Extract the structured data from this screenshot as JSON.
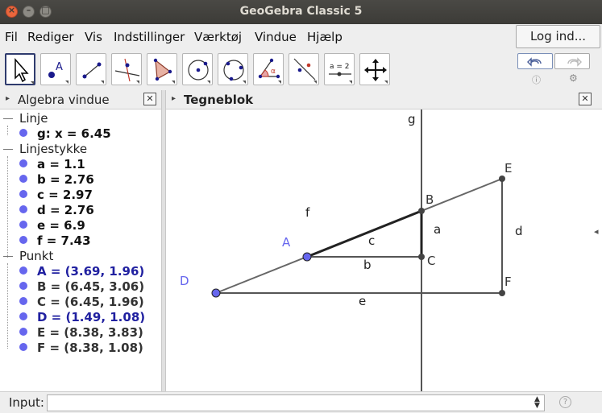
{
  "window": {
    "title": "GeoGebra Classic 5"
  },
  "menu": {
    "items": [
      "Fil",
      "Rediger",
      "Vis",
      "Indstillinger",
      "Værktøj",
      "Vindue",
      "Hjælp"
    ],
    "login_label": "Log ind..."
  },
  "toolbar": {
    "tools": [
      "move-tool",
      "point-tool",
      "segment-tool",
      "perpendicular-line-tool",
      "polygon-tool",
      "circle-center-point-tool",
      "circle-three-points-tool",
      "angle-tool",
      "reflect-tool",
      "slider-tool",
      "move-graphics-view-tool"
    ],
    "slider_label": "a = 2",
    "point_label": "A",
    "angle_label": "α"
  },
  "algebra": {
    "title": "Algebra vindue",
    "categories": [
      {
        "name": "Linje",
        "items": [
          "g: x = 6.45"
        ]
      },
      {
        "name": "Linjestykke",
        "items": [
          "a = 1.1",
          "b = 2.76",
          "c = 2.97",
          "d = 2.76",
          "e = 6.9",
          "f = 7.43"
        ]
      },
      {
        "name": "Punkt",
        "items": [
          "A = (3.69, 1.96)",
          "B = (6.45, 3.06)",
          "C = (6.45, 1.96)",
          "D = (1.49, 1.08)",
          "E = (8.38, 3.83)",
          "F = (8.38, 1.08)"
        ]
      }
    ]
  },
  "graphics": {
    "title": "Tegneblok",
    "labels": {
      "line_g": "g",
      "segment_f": "f",
      "segment_c": "c",
      "segment_a": "a",
      "segment_b": "b",
      "segment_d": "d",
      "segment_e": "e",
      "point_A": "A",
      "point_B": "B",
      "point_C": "C",
      "point_D": "D",
      "point_E": "E",
      "point_F": "F"
    },
    "points": {
      "A": [
        3.69,
        1.96
      ],
      "B": [
        6.45,
        3.06
      ],
      "C": [
        6.45,
        1.96
      ],
      "D": [
        1.49,
        1.08
      ],
      "E": [
        8.38,
        3.83
      ],
      "F": [
        8.38,
        1.08
      ]
    },
    "line_g_x": 6.45
  },
  "input": {
    "label": "Input:",
    "value": ""
  },
  "colors": {
    "free_point": "#6666ee",
    "dependent_point": "#444444",
    "title_bar": "#3c3b37",
    "selected_tool_border": "#2f3b6e"
  }
}
